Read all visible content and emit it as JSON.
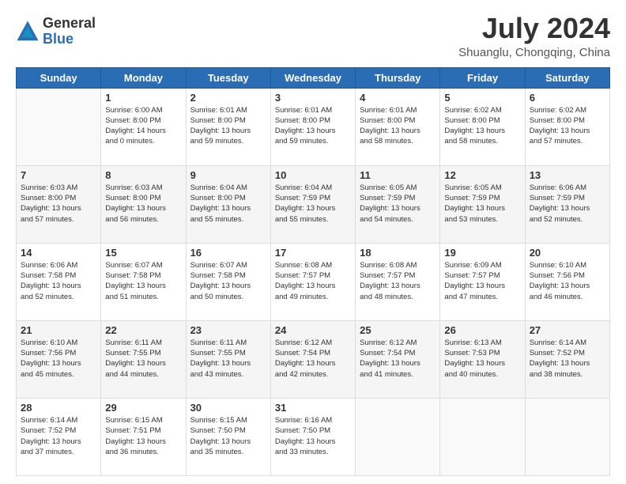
{
  "header": {
    "logo_line1": "General",
    "logo_line2": "Blue",
    "month_year": "July 2024",
    "location": "Shuanglu, Chongqing, China"
  },
  "days_of_week": [
    "Sunday",
    "Monday",
    "Tuesday",
    "Wednesday",
    "Thursday",
    "Friday",
    "Saturday"
  ],
  "weeks": [
    [
      {
        "day": "",
        "info": ""
      },
      {
        "day": "1",
        "info": "Sunrise: 6:00 AM\nSunset: 8:00 PM\nDaylight: 14 hours\nand 0 minutes."
      },
      {
        "day": "2",
        "info": "Sunrise: 6:01 AM\nSunset: 8:00 PM\nDaylight: 13 hours\nand 59 minutes."
      },
      {
        "day": "3",
        "info": "Sunrise: 6:01 AM\nSunset: 8:00 PM\nDaylight: 13 hours\nand 59 minutes."
      },
      {
        "day": "4",
        "info": "Sunrise: 6:01 AM\nSunset: 8:00 PM\nDaylight: 13 hours\nand 58 minutes."
      },
      {
        "day": "5",
        "info": "Sunrise: 6:02 AM\nSunset: 8:00 PM\nDaylight: 13 hours\nand 58 minutes."
      },
      {
        "day": "6",
        "info": "Sunrise: 6:02 AM\nSunset: 8:00 PM\nDaylight: 13 hours\nand 57 minutes."
      }
    ],
    [
      {
        "day": "7",
        "info": "Sunrise: 6:03 AM\nSunset: 8:00 PM\nDaylight: 13 hours\nand 57 minutes."
      },
      {
        "day": "8",
        "info": "Sunrise: 6:03 AM\nSunset: 8:00 PM\nDaylight: 13 hours\nand 56 minutes."
      },
      {
        "day": "9",
        "info": "Sunrise: 6:04 AM\nSunset: 8:00 PM\nDaylight: 13 hours\nand 55 minutes."
      },
      {
        "day": "10",
        "info": "Sunrise: 6:04 AM\nSunset: 7:59 PM\nDaylight: 13 hours\nand 55 minutes."
      },
      {
        "day": "11",
        "info": "Sunrise: 6:05 AM\nSunset: 7:59 PM\nDaylight: 13 hours\nand 54 minutes."
      },
      {
        "day": "12",
        "info": "Sunrise: 6:05 AM\nSunset: 7:59 PM\nDaylight: 13 hours\nand 53 minutes."
      },
      {
        "day": "13",
        "info": "Sunrise: 6:06 AM\nSunset: 7:59 PM\nDaylight: 13 hours\nand 52 minutes."
      }
    ],
    [
      {
        "day": "14",
        "info": "Sunrise: 6:06 AM\nSunset: 7:58 PM\nDaylight: 13 hours\nand 52 minutes."
      },
      {
        "day": "15",
        "info": "Sunrise: 6:07 AM\nSunset: 7:58 PM\nDaylight: 13 hours\nand 51 minutes."
      },
      {
        "day": "16",
        "info": "Sunrise: 6:07 AM\nSunset: 7:58 PM\nDaylight: 13 hours\nand 50 minutes."
      },
      {
        "day": "17",
        "info": "Sunrise: 6:08 AM\nSunset: 7:57 PM\nDaylight: 13 hours\nand 49 minutes."
      },
      {
        "day": "18",
        "info": "Sunrise: 6:08 AM\nSunset: 7:57 PM\nDaylight: 13 hours\nand 48 minutes."
      },
      {
        "day": "19",
        "info": "Sunrise: 6:09 AM\nSunset: 7:57 PM\nDaylight: 13 hours\nand 47 minutes."
      },
      {
        "day": "20",
        "info": "Sunrise: 6:10 AM\nSunset: 7:56 PM\nDaylight: 13 hours\nand 46 minutes."
      }
    ],
    [
      {
        "day": "21",
        "info": "Sunrise: 6:10 AM\nSunset: 7:56 PM\nDaylight: 13 hours\nand 45 minutes."
      },
      {
        "day": "22",
        "info": "Sunrise: 6:11 AM\nSunset: 7:55 PM\nDaylight: 13 hours\nand 44 minutes."
      },
      {
        "day": "23",
        "info": "Sunrise: 6:11 AM\nSunset: 7:55 PM\nDaylight: 13 hours\nand 43 minutes."
      },
      {
        "day": "24",
        "info": "Sunrise: 6:12 AM\nSunset: 7:54 PM\nDaylight: 13 hours\nand 42 minutes."
      },
      {
        "day": "25",
        "info": "Sunrise: 6:12 AM\nSunset: 7:54 PM\nDaylight: 13 hours\nand 41 minutes."
      },
      {
        "day": "26",
        "info": "Sunrise: 6:13 AM\nSunset: 7:53 PM\nDaylight: 13 hours\nand 40 minutes."
      },
      {
        "day": "27",
        "info": "Sunrise: 6:14 AM\nSunset: 7:52 PM\nDaylight: 13 hours\nand 38 minutes."
      }
    ],
    [
      {
        "day": "28",
        "info": "Sunrise: 6:14 AM\nSunset: 7:52 PM\nDaylight: 13 hours\nand 37 minutes."
      },
      {
        "day": "29",
        "info": "Sunrise: 6:15 AM\nSunset: 7:51 PM\nDaylight: 13 hours\nand 36 minutes."
      },
      {
        "day": "30",
        "info": "Sunrise: 6:15 AM\nSunset: 7:50 PM\nDaylight: 13 hours\nand 35 minutes."
      },
      {
        "day": "31",
        "info": "Sunrise: 6:16 AM\nSunset: 7:50 PM\nDaylight: 13 hours\nand 33 minutes."
      },
      {
        "day": "",
        "info": ""
      },
      {
        "day": "",
        "info": ""
      },
      {
        "day": "",
        "info": ""
      }
    ]
  ]
}
